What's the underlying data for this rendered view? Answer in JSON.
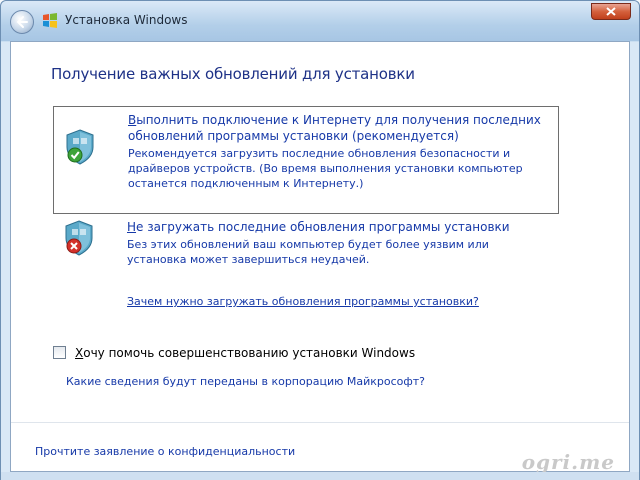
{
  "window": {
    "title": "Установка Windows"
  },
  "heading": "Получение важных обновлений для установки",
  "options": [
    {
      "accel": "В",
      "title_rest": "ыполнить подключение к Интернету для получения последних обновлений программы установки (рекомендуется)",
      "description": "Рекомендуется загрузить последние обновления безопасности и драйверов устройств. (Во время выполнения установки компьютер останется подключенным к Интернету.)",
      "icon": "shield-green-check-icon"
    },
    {
      "accel": "Н",
      "title_rest": "е загружать последние обновления программы установки",
      "description": "Без этих обновлений ваш компьютер будет более уязвим или установка может завершиться неудачей.",
      "icon": "shield-red-x-icon"
    }
  ],
  "links": {
    "why": "Зачем нужно загружать обновления программы установки?",
    "info_sent": "Какие сведения будут переданы в корпорацию Майкрософт?",
    "privacy": "Прочтите заявление о конфиденциальности"
  },
  "checkbox": {
    "accel": "Х",
    "label_rest": "очу помочь совершенствованию установки Windows",
    "checked": false
  },
  "watermark": "ogri.me",
  "colors": {
    "link": "#1639a8",
    "heading": "#1e3287",
    "frame": "#b9d3ec"
  }
}
